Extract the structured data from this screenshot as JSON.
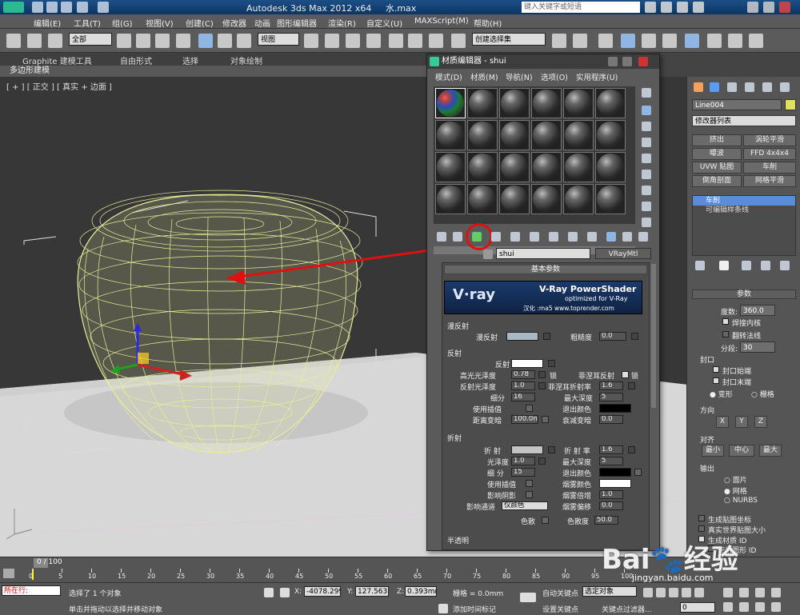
{
  "app": {
    "title": "Autodesk 3ds Max  2012 x64",
    "file": "水.max",
    "search_placeholder": "键入关键字或短语"
  },
  "menubar": [
    "编辑(E)",
    "工具(T)",
    "组(G)",
    "视图(V)",
    "创建(C)",
    "修改器",
    "动画",
    "图形编辑器",
    "渲染(R)",
    "自定义(U)",
    "MAXScript(M)",
    "帮助(H)"
  ],
  "toolbar": {
    "select_filter": "全部",
    "ref_coord": "视图",
    "named_selection": "创建选择集"
  },
  "ribbon": {
    "tabs": [
      "Graphite 建模工具",
      "自由形式",
      "选择",
      "对象绘制"
    ],
    "sub": "多边形建模"
  },
  "viewport": {
    "label": "[ + ] [ 正交 ] [ 真实 + 边面 ]"
  },
  "material_editor": {
    "title": "材质编辑器 - shui",
    "menu": [
      "模式(D)",
      "材质(M)",
      "导航(N)",
      "选项(O)",
      "实用程序(U)"
    ],
    "material_name": "shui",
    "material_type": "VRayMtl",
    "rollout_basic": "基本参数",
    "logo_title": "V-Ray PowerShader",
    "logo_sub": "optimized for V-Ray",
    "logo_credit": "汉化 :ma5 www.toprender.com",
    "diffuse": {
      "group": "漫反射",
      "diffuse_label": "漫反射",
      "roughness_label": "粗糙度",
      "roughness": "0.0",
      "diffuse_color": "#a8b8c4"
    },
    "reflection": {
      "group": "反射",
      "reflect_label": "反射",
      "hilight_gloss_label": "高光光泽度",
      "hilight_gloss": "0.78",
      "lock_label": "锁",
      "fresnel_label": "菲涅耳反射",
      "fresnel_lock_label": "锁",
      "refl_gloss_label": "反射光泽度",
      "refl_gloss": "1.0",
      "fresnel_ior_label": "菲涅耳折射率",
      "fresnel_ior": "1.6",
      "subdivs_label": "细分",
      "subdivs": "16",
      "max_depth_label": "最大深度",
      "max_depth": "5",
      "interp_label": "使用插值",
      "exit_color_label": "退出颜色",
      "dim_dist_label": "距离变暗",
      "dim_dist": "100.0n",
      "dim_falloff_label": "衰减变暗",
      "dim_falloff": "0.0",
      "reflect_color": "#ffffff",
      "exit_color": "#000000"
    },
    "refraction": {
      "group": "折射",
      "refract_label": "折 射",
      "ior_label": "折 射 率",
      "ior": "1.6",
      "gloss_label": "光泽度",
      "gloss": "1.0",
      "max_depth_label": "最大深度",
      "max_depth": "5",
      "subdivs_label": "细 分",
      "subdivs": "15",
      "exit_color_label": "退出颜色",
      "interp_label": "使用插值",
      "fog_color_label": "烟雾颜色",
      "shadows_label": "影响阴影",
      "fog_mult_label": "烟雾倍增",
      "fog_mult": "1.0",
      "channels_label": "影响通道",
      "channels": "仅颜色",
      "fog_bias_label": "烟雾偏移",
      "fog_bias": "0.0",
      "dispersion_label": "色散",
      "abbe_label": "色散度",
      "abbe": "50.0",
      "refract_color": "#c4c4c4",
      "exit_color": "#000000",
      "fog_color": "#ffffff"
    },
    "translucency_label": "半透明"
  },
  "right_panel": {
    "object_name": "Line004",
    "modifier_list": "修改器列表",
    "buttons": [
      "挤出",
      "涡轮平滑",
      "曝波",
      "FFD 4x4x4",
      "UVW 贴图",
      "车削",
      "倒角剖面",
      "网格平滑"
    ],
    "stack": [
      "车削",
      "可编辑样条线"
    ],
    "params_title": "参数",
    "degrees_label": "度数:",
    "degrees": "360.0",
    "weld_core": "焊接内核",
    "flip_normals": "翻转法线",
    "segments_label": "分段:",
    "segments": "30",
    "capping": "封口",
    "cap_start": "封口始端",
    "cap_end": "封口末端",
    "morph": "变形",
    "grid": "栅格",
    "direction": "方向",
    "dir_x": "X",
    "dir_y": "Y",
    "dir_z": "Z",
    "align": "对齐",
    "align_min": "最小",
    "align_center": "中心",
    "align_max": "最大",
    "output": "输出",
    "out_patch": "面片",
    "out_mesh": "网格",
    "out_nurbs": "NURBS",
    "gen_map": "生成贴图坐标",
    "real_world": "真实世界贴图大小",
    "gen_mat_id": "生成材质 ID",
    "use_shape_id": "使用图形 ID"
  },
  "timeline": {
    "frame": "0 / 100",
    "ticks": [
      "0",
      "5",
      "10",
      "15",
      "20",
      "25",
      "30",
      "35",
      "40",
      "45",
      "50",
      "55",
      "60",
      "65",
      "70",
      "75",
      "80",
      "85",
      "90",
      "95",
      "100"
    ]
  },
  "status": {
    "left_label": "所在行:",
    "selected": "选择了 1 个对象",
    "hint": "单击并拖动以选择并移动对象",
    "x_label": "X:",
    "x": "-4078.299",
    "y_label": "Y:",
    "y": "127.563mm",
    "z_label": "Z:",
    "z": "0.393mm",
    "grid": "栅格 = 0.0mm",
    "autokey": "自动关键点",
    "selected_obj": "选定对象",
    "set_key": "设置关键点",
    "key_filters": "关键点过滤器...",
    "add_time_tag": "添加时间标记",
    "frame_field": "0"
  },
  "watermark": {
    "brand": "Bai",
    "brand_cn": "经验",
    "url": "jingyan.baidu.com"
  },
  "colors": {
    "wire": "#e8ec9a",
    "annot": "#e01010"
  }
}
